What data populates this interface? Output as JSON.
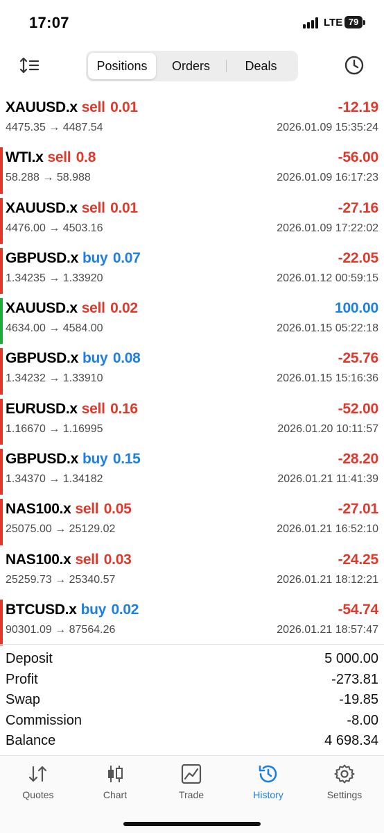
{
  "status_bar": {
    "time": "17:07",
    "network": "LTE",
    "battery": "79"
  },
  "tabs": [
    {
      "label": "Positions",
      "active": true
    },
    {
      "label": "Orders",
      "active": false
    },
    {
      "label": "Deals",
      "active": false
    }
  ],
  "deals": [
    {
      "symbol": "XAUUSD.x",
      "side": "sell",
      "volume": "0.01",
      "prices": "4475.35 → 4487.54",
      "datetime": "2026.01.09 15:35:24",
      "profit": "-12.19",
      "marker": "none"
    },
    {
      "symbol": "WTI.x",
      "side": "sell",
      "volume": "0.8",
      "prices": "58.288 → 58.988",
      "datetime": "2026.01.09 16:17:23",
      "profit": "-56.00",
      "marker": "red"
    },
    {
      "symbol": "XAUUSD.x",
      "side": "sell",
      "volume": "0.01",
      "prices": "4476.00 → 4503.16",
      "datetime": "2026.01.09 17:22:02",
      "profit": "-27.16",
      "marker": "red"
    },
    {
      "symbol": "GBPUSD.x",
      "side": "buy",
      "volume": "0.07",
      "prices": "1.34235 → 1.33920",
      "datetime": "2026.01.12 00:59:15",
      "profit": "-22.05",
      "marker": "red"
    },
    {
      "symbol": "XAUUSD.x",
      "side": "sell",
      "volume": "0.02",
      "prices": "4634.00 → 4584.00",
      "datetime": "2026.01.15 05:22:18",
      "profit": "100.00",
      "marker": "green"
    },
    {
      "symbol": "GBPUSD.x",
      "side": "buy",
      "volume": "0.08",
      "prices": "1.34232 → 1.33910",
      "datetime": "2026.01.15 15:16:36",
      "profit": "-25.76",
      "marker": "red"
    },
    {
      "symbol": "EURUSD.x",
      "side": "sell",
      "volume": "0.16",
      "prices": "1.16670 → 1.16995",
      "datetime": "2026.01.20 10:11:57",
      "profit": "-52.00",
      "marker": "red"
    },
    {
      "symbol": "GBPUSD.x",
      "side": "buy",
      "volume": "0.15",
      "prices": "1.34370 → 1.34182",
      "datetime": "2026.01.21 11:41:39",
      "profit": "-28.20",
      "marker": "red"
    },
    {
      "symbol": "NAS100.x",
      "side": "sell",
      "volume": "0.05",
      "prices": "25075.00 → 25129.02",
      "datetime": "2026.01.21 16:52:10",
      "profit": "-27.01",
      "marker": "red"
    },
    {
      "symbol": "NAS100.x",
      "side": "sell",
      "volume": "0.03",
      "prices": "25259.73 → 25340.57",
      "datetime": "2026.01.21 18:12:21",
      "profit": "-24.25",
      "marker": "none"
    },
    {
      "symbol": "BTCUSD.x",
      "side": "buy",
      "volume": "0.02",
      "prices": "90301.09 → 87564.26",
      "datetime": "2026.01.21 18:57:47",
      "profit": "-54.74",
      "marker": "red"
    }
  ],
  "summary": [
    {
      "label": "Deposit",
      "value": "5 000.00"
    },
    {
      "label": "Profit",
      "value": "-273.81"
    },
    {
      "label": "Swap",
      "value": "-19.85"
    },
    {
      "label": "Commission",
      "value": "-8.00"
    },
    {
      "label": "Balance",
      "value": "4 698.34"
    }
  ],
  "nav": [
    {
      "label": "Quotes",
      "icon": "quotes-icon",
      "active": false
    },
    {
      "label": "Chart",
      "icon": "chart-candles-icon",
      "active": false
    },
    {
      "label": "Trade",
      "icon": "trade-icon",
      "active": false
    },
    {
      "label": "History",
      "icon": "history-icon",
      "active": true
    },
    {
      "label": "Settings",
      "icon": "gear-icon",
      "active": false
    }
  ],
  "colors": {
    "loss": "#e0392b",
    "gain": "#1d7fe0",
    "buy": "#1d7fe0",
    "sell": "#e0392b",
    "marker_red": "#e0392b",
    "marker_green": "#1faa3b",
    "active_tab": "#1d7fe0"
  }
}
